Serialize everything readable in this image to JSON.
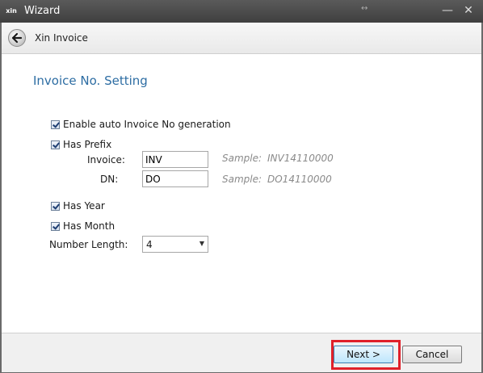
{
  "window": {
    "app_icon": "xin",
    "title": "Wizard",
    "grip_glyph": "↔",
    "minimize_glyph": "—",
    "close_glyph": "✕"
  },
  "header": {
    "back_icon": "back-arrow-icon",
    "title": "Xin Invoice"
  },
  "section": {
    "title": "Invoice No. Setting"
  },
  "options": {
    "enable_auto": {
      "label": "Enable auto Invoice No generation",
      "checked": true
    },
    "has_prefix": {
      "label": "Has Prefix",
      "checked": true
    },
    "invoice": {
      "label": "Invoice:",
      "value": "INV",
      "sample_label": "Sample:",
      "sample_value": "INV14110000"
    },
    "dn": {
      "label": "DN:",
      "value": "DO",
      "sample_label": "Sample:",
      "sample_value": "DO14110000"
    },
    "has_year": {
      "label": "Has Year",
      "checked": true
    },
    "has_month": {
      "label": "Has Month",
      "checked": true
    },
    "number_length": {
      "label": "Number Length:",
      "value": "4",
      "arrow": "▼"
    }
  },
  "footer": {
    "next_label": "Next >",
    "cancel_label": "Cancel",
    "highlight_color": "#e0202a"
  }
}
